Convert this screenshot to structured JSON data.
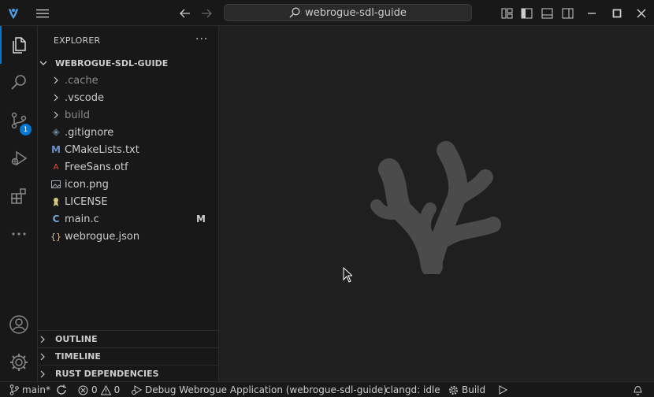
{
  "titlebar": {
    "search_text": "webrogue-sdl-guide"
  },
  "activity": {
    "source_control_badge": "1"
  },
  "explorer": {
    "title": "EXPLORER",
    "more": "···",
    "root": "WEBROGUE-SDL-GUIDE",
    "items": [
      {
        "label": ".cache",
        "kind": "folder",
        "dim": true
      },
      {
        "label": ".vscode",
        "kind": "folder",
        "dim": false
      },
      {
        "label": "build",
        "kind": "folder",
        "dim": true
      },
      {
        "label": ".gitignore",
        "kind": "file",
        "icon": "gitignore-icon",
        "dim": false
      },
      {
        "label": "CMakeLists.txt",
        "kind": "file",
        "icon": "cmake-icon",
        "dim": false
      },
      {
        "label": "FreeSans.otf",
        "kind": "file",
        "icon": "font-icon",
        "dim": false
      },
      {
        "label": "icon.png",
        "kind": "file",
        "icon": "image-icon",
        "dim": false
      },
      {
        "label": "LICENSE",
        "kind": "file",
        "icon": "license-icon",
        "dim": false
      },
      {
        "label": "main.c",
        "kind": "file",
        "icon": "c-file-icon",
        "dim": false,
        "status": "M"
      },
      {
        "label": "webrogue.json",
        "kind": "file",
        "icon": "json-icon",
        "dim": false
      }
    ],
    "sections": {
      "outline": "OUTLINE",
      "timeline": "TIMELINE",
      "rust": "RUST DEPENDENCIES"
    }
  },
  "statusbar": {
    "branch": "main*",
    "errors": "0",
    "warnings": "0",
    "debug": "Debug Webrogue Application (webrogue-sdl-guide)",
    "clangd": "clangd: idle",
    "build": "Build"
  },
  "colors": {
    "accent": "#0078d4",
    "background": "#1f1f1f",
    "sidebar": "#181818",
    "watermark": "#4b4b4b"
  }
}
